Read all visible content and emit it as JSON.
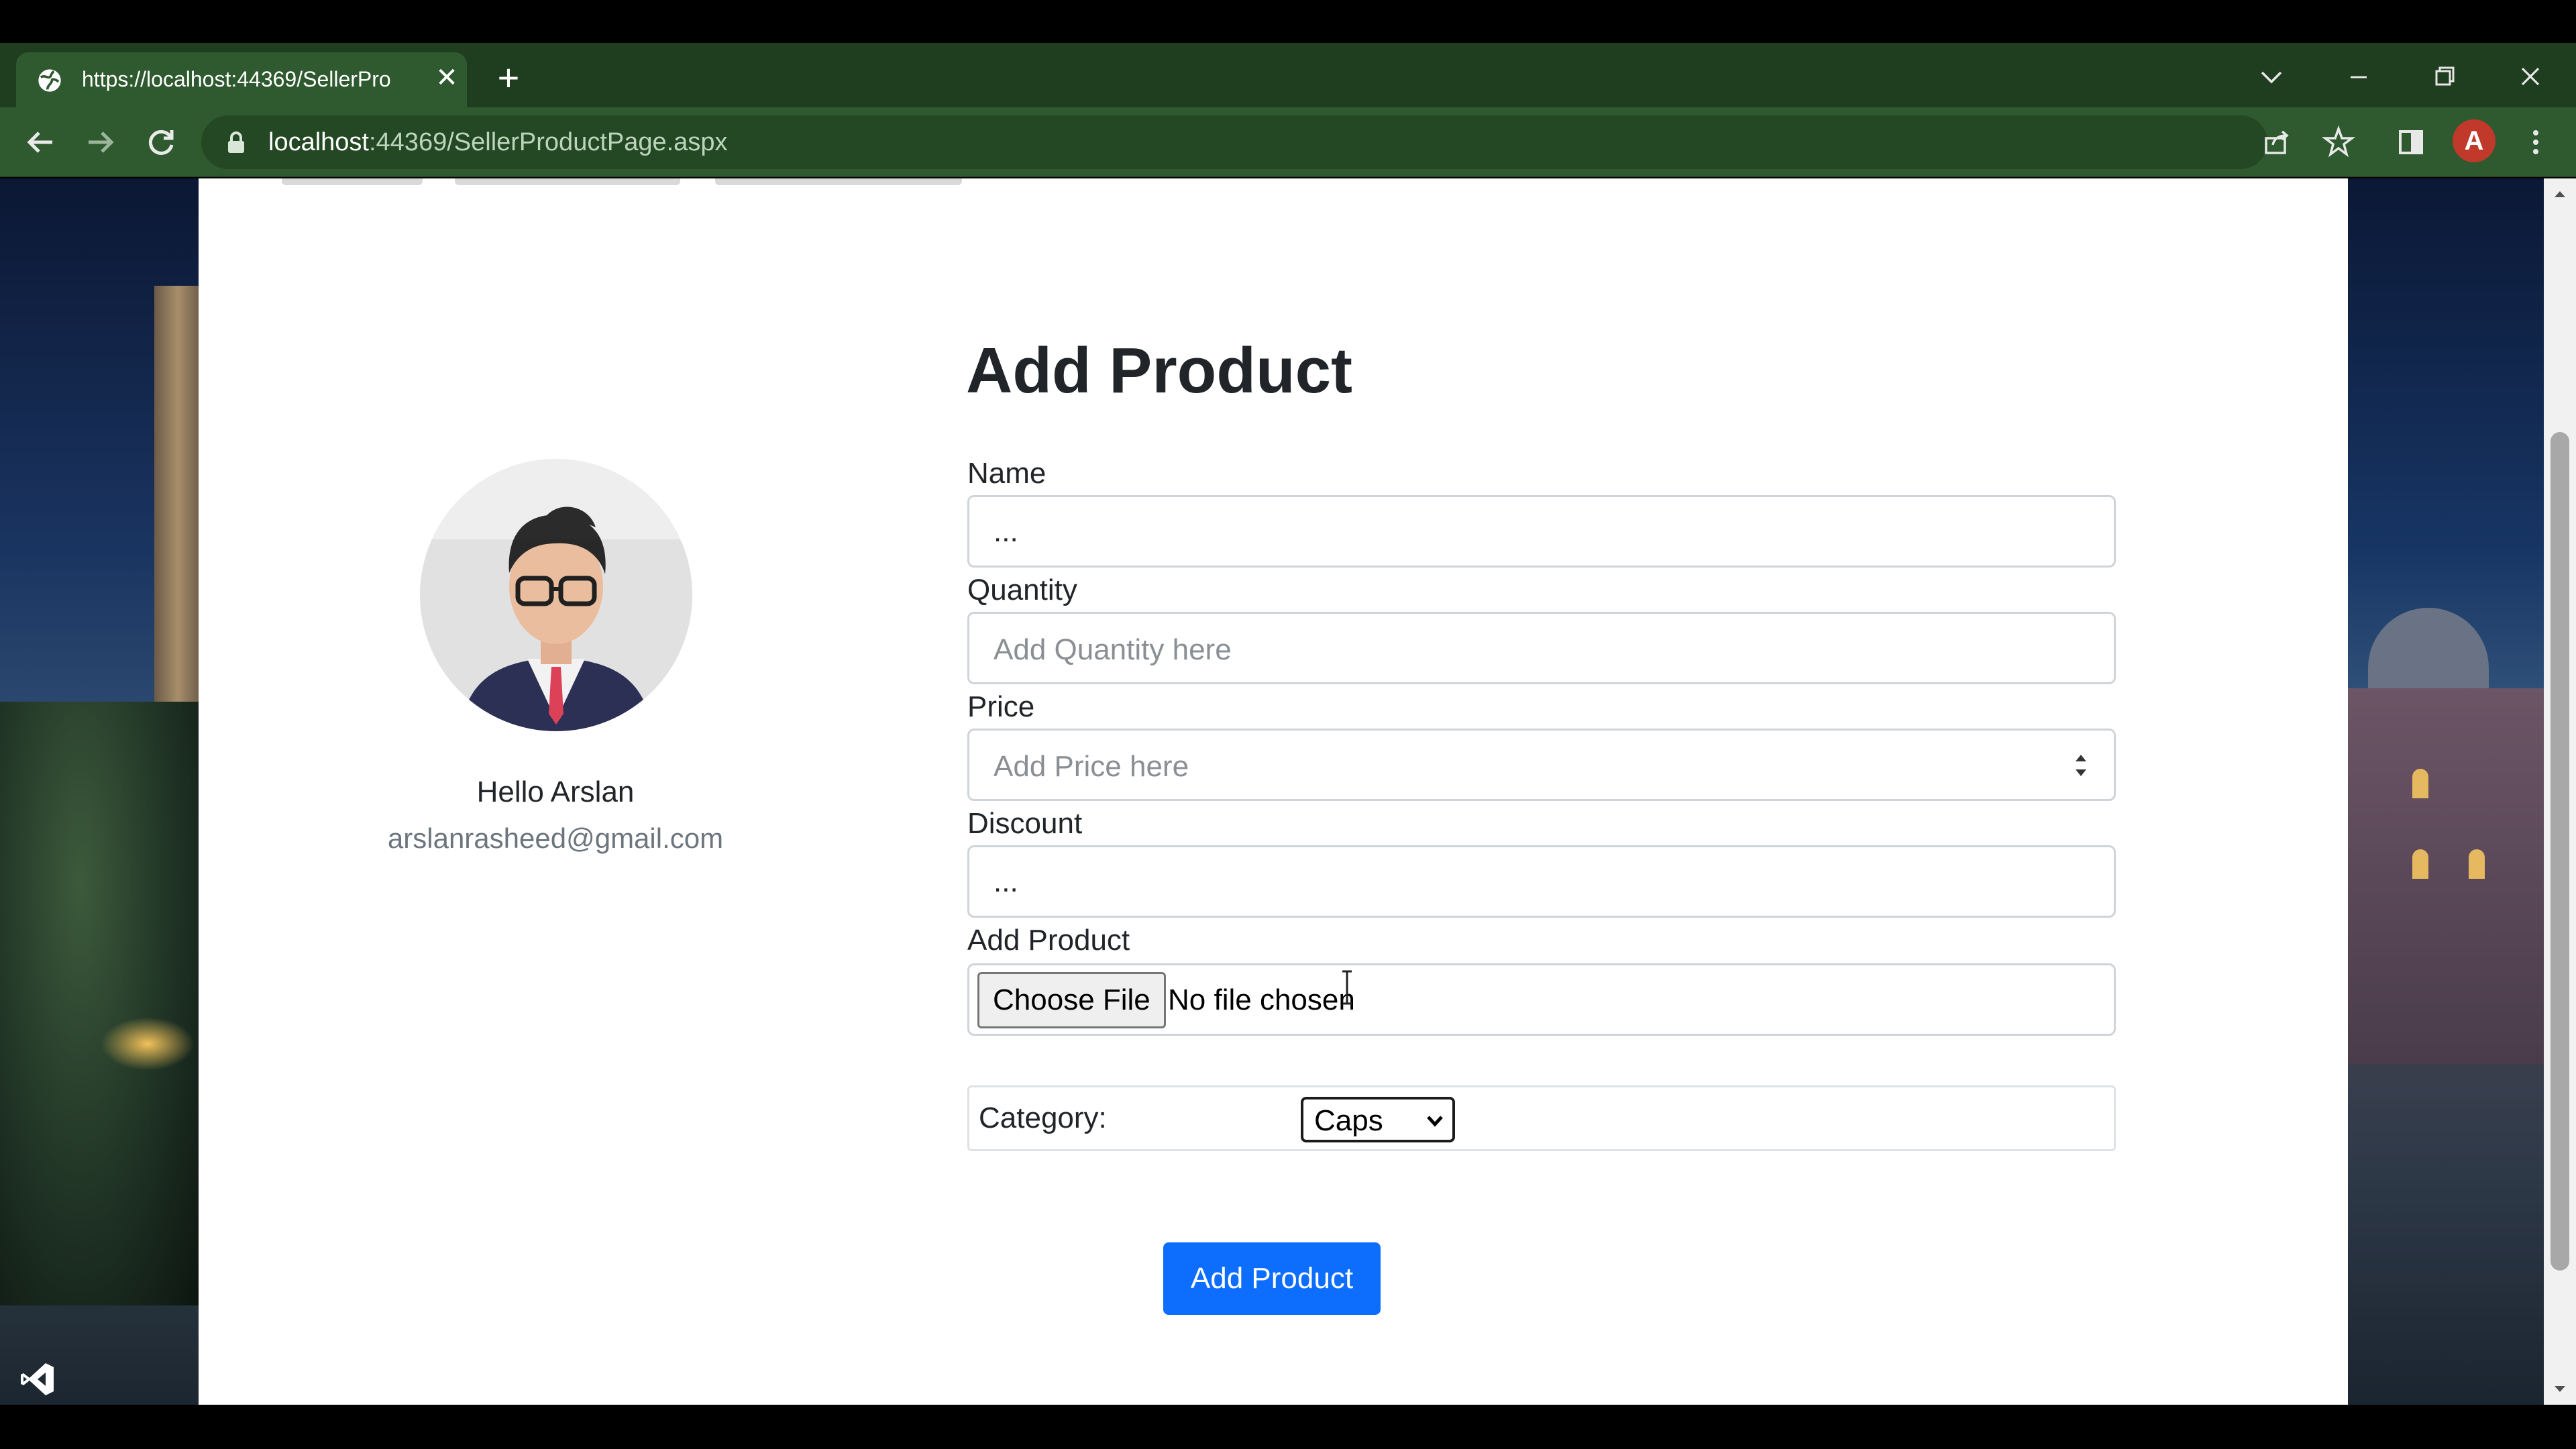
{
  "browser": {
    "tab_title": "https://localhost:44369/SellerPro",
    "tab_close": "✕",
    "new_tab": "+",
    "url_host": "localhost",
    "url_rest": ":44369/SellerProductPage.aspx",
    "profile_initial": "A",
    "icons": [
      "globe-icon",
      "back-icon",
      "forward-icon",
      "reload-icon",
      "lock-icon",
      "share-icon",
      "star-icon",
      "sidepanel-icon",
      "menu-icon",
      "chevron-down-icon",
      "minimize-icon",
      "restore-icon",
      "close-icon"
    ]
  },
  "profile": {
    "greeting": "Hello Arslan",
    "email": "arslanrasheed@gmail.com"
  },
  "form": {
    "heading": "Add Product",
    "name_label": "Name",
    "name_value": "...",
    "quantity_label": "Quantity",
    "quantity_placeholder": "Add Quantity here",
    "price_label": "Price",
    "price_placeholder": "Add Price here",
    "discount_label": "Discount",
    "discount_value": "...",
    "image_label": "Add Product",
    "choose_file": "Choose File",
    "no_file": "No file chosen",
    "category_label": "Category:",
    "category_value": "Caps",
    "submit": "Add Product"
  },
  "colors": {
    "accent": "#0d6efd",
    "browser_frame": "#2f5a2f",
    "tab_strip": "#1f3d1f"
  }
}
